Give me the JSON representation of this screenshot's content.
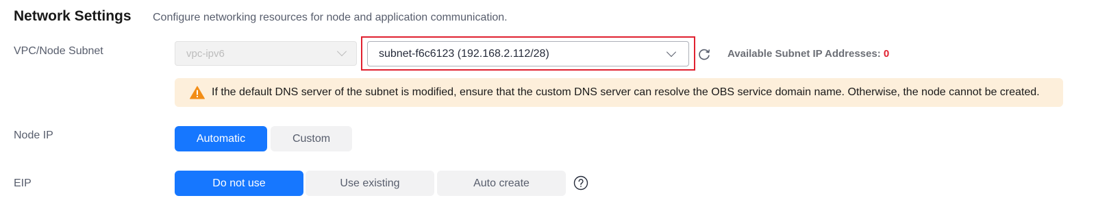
{
  "header": {
    "title": "Network Settings",
    "description": "Configure networking resources for node and application communication."
  },
  "vpc_subnet": {
    "label": "VPC/Node Subnet",
    "vpc_value": "vpc-ipv6",
    "subnet_value": "subnet-f6c6123 (192.168.2.112/28)",
    "available_label": "Available Subnet IP Addresses:",
    "available_count": "0",
    "highlight_color": "#e0202f"
  },
  "alert": {
    "icon": "warning-icon",
    "text": "If the default DNS server of the subnet is modified, ensure that the custom DNS server can resolve the OBS service domain name. Otherwise, the node cannot be created."
  },
  "node_ip": {
    "label": "Node IP",
    "options": [
      "Automatic",
      "Custom"
    ],
    "selected": "Automatic"
  },
  "eip": {
    "label": "EIP",
    "options": [
      "Do not use",
      "Use existing",
      "Auto create"
    ],
    "selected": "Do not use"
  },
  "colors": {
    "accent": "#1677ff",
    "alert_bg": "#fdefdb",
    "warning": "#f28d16",
    "error": "#e0202f"
  }
}
